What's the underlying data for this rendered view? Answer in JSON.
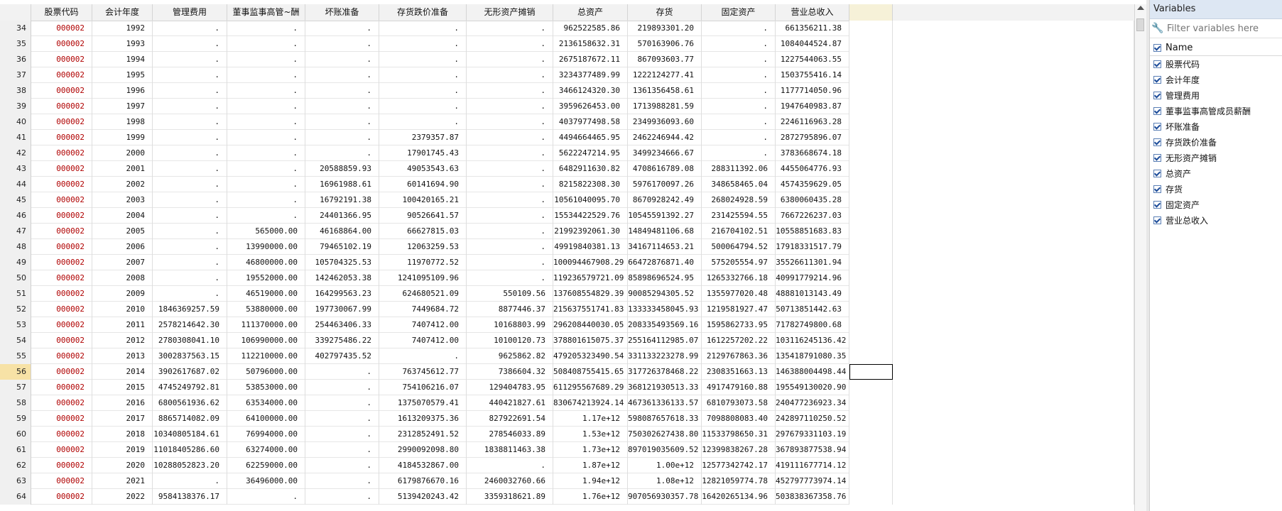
{
  "columns": [
    "",
    "股票代码",
    "会计年度",
    "管理费用",
    "董事监事高管~酬",
    "坏账准备",
    "存货跌价准备",
    "无形资产摊销",
    "总资产",
    "存货",
    "固定资产",
    "营业总收入",
    ""
  ],
  "rows": [
    [
      "34",
      "000002",
      "1992",
      ".",
      ".",
      ".",
      ".",
      ".",
      "962522585.86",
      "219893301.20",
      ".",
      "661356211.38"
    ],
    [
      "35",
      "000002",
      "1993",
      ".",
      ".",
      ".",
      ".",
      ".",
      "2136158632.31",
      "570163906.76",
      ".",
      "1084044524.87"
    ],
    [
      "36",
      "000002",
      "1994",
      ".",
      ".",
      ".",
      ".",
      ".",
      "2675187672.11",
      "867093603.77",
      ".",
      "1227544063.55"
    ],
    [
      "37",
      "000002",
      "1995",
      ".",
      ".",
      ".",
      ".",
      ".",
      "3234377489.99",
      "1222124277.41",
      ".",
      "1503755416.14"
    ],
    [
      "38",
      "000002",
      "1996",
      ".",
      ".",
      ".",
      ".",
      ".",
      "3466124320.30",
      "1361356458.61",
      ".",
      "1177714050.96"
    ],
    [
      "39",
      "000002",
      "1997",
      ".",
      ".",
      ".",
      ".",
      ".",
      "3959626453.00",
      "1713988281.59",
      ".",
      "1947640983.87"
    ],
    [
      "40",
      "000002",
      "1998",
      ".",
      ".",
      ".",
      ".",
      ".",
      "4037977498.58",
      "2349936093.60",
      ".",
      "2246116963.28"
    ],
    [
      "41",
      "000002",
      "1999",
      ".",
      ".",
      ".",
      "2379357.87",
      ".",
      "4494664465.95",
      "2462246944.42",
      ".",
      "2872795896.07"
    ],
    [
      "42",
      "000002",
      "2000",
      ".",
      ".",
      ".",
      "17901745.43",
      ".",
      "5622247214.95",
      "3499234666.67",
      ".",
      "3783668674.18"
    ],
    [
      "43",
      "000002",
      "2001",
      ".",
      ".",
      "20588859.93",
      "49053543.63",
      ".",
      "6482911630.82",
      "4708616789.08",
      "288311392.06",
      "4455064776.93"
    ],
    [
      "44",
      "000002",
      "2002",
      ".",
      ".",
      "16961988.61",
      "60141694.90",
      ".",
      "8215822308.30",
      "5976170097.26",
      "348658465.04",
      "4574359629.05"
    ],
    [
      "45",
      "000002",
      "2003",
      ".",
      ".",
      "16792191.38",
      "100420165.21",
      ".",
      "10561040095.70",
      "8670928242.49",
      "268024928.59",
      "6380060435.28"
    ],
    [
      "46",
      "000002",
      "2004",
      ".",
      ".",
      "24401366.95",
      "90526641.57",
      ".",
      "15534422529.76",
      "10545591392.27",
      "231425594.55",
      "7667226237.03"
    ],
    [
      "47",
      "000002",
      "2005",
      ".",
      "565000.00",
      "46168864.00",
      "66627815.03",
      ".",
      "21992392061.30",
      "14849481106.68",
      "216704102.51",
      "10558851683.83"
    ],
    [
      "48",
      "000002",
      "2006",
      ".",
      "13990000.00",
      "79465102.19",
      "12063259.53",
      ".",
      "49919840381.13",
      "34167114653.21",
      "500064794.52",
      "17918331517.79"
    ],
    [
      "49",
      "000002",
      "2007",
      ".",
      "46800000.00",
      "105704325.53",
      "11970772.52",
      ".",
      "100094467908.29",
      "66472876871.40",
      "575205554.97",
      "35526611301.94"
    ],
    [
      "50",
      "000002",
      "2008",
      ".",
      "19552000.00",
      "142462053.38",
      "1241095109.96",
      ".",
      "119236579721.09",
      "85898696524.95",
      "1265332766.18",
      "40991779214.96"
    ],
    [
      "51",
      "000002",
      "2009",
      ".",
      "46519000.00",
      "164299563.23",
      "624680521.09",
      "550109.56",
      "137608554829.39",
      "90085294305.52",
      "1355977020.48",
      "48881013143.49"
    ],
    [
      "52",
      "000002",
      "2010",
      "1846369257.59",
      "53880000.00",
      "197730067.99",
      "7449684.72",
      "8877446.37",
      "215637551741.83",
      "133333458045.93",
      "1219581927.47",
      "50713851442.63"
    ],
    [
      "53",
      "000002",
      "2011",
      "2578214642.30",
      "111370000.00",
      "254463406.33",
      "7407412.00",
      "10168803.99",
      "296208440030.05",
      "208335493569.16",
      "1595862733.95",
      "71782749800.68"
    ],
    [
      "54",
      "000002",
      "2012",
      "2780308041.10",
      "106990000.00",
      "339275486.22",
      "7407412.00",
      "10100120.73",
      "378801615075.37",
      "255164112985.07",
      "1612257202.22",
      "103116245136.42"
    ],
    [
      "55",
      "000002",
      "2013",
      "3002837563.15",
      "112210000.00",
      "402797435.52",
      ".",
      "9625862.82",
      "479205323490.54",
      "331133223278.99",
      "2129767863.36",
      "135418791080.35"
    ],
    [
      "56",
      "000002",
      "2014",
      "3902617687.02",
      "50796000.00",
      ".",
      "763745612.77",
      "7386604.32",
      "508408755415.65",
      "317726378468.22",
      "2308351663.13",
      "146388004498.44"
    ],
    [
      "57",
      "000002",
      "2015",
      "4745249792.81",
      "53853000.00",
      ".",
      "754106216.07",
      "129404783.95",
      "611295567689.29",
      "368121930513.33",
      "4917479160.88",
      "195549130020.90"
    ],
    [
      "58",
      "000002",
      "2016",
      "6800561936.62",
      "63534000.00",
      ".",
      "1375070579.41",
      "440421827.61",
      "830674213924.14",
      "467361336133.57",
      "6810793073.58",
      "240477236923.34"
    ],
    [
      "59",
      "000002",
      "2017",
      "8865714082.09",
      "64100000.00",
      ".",
      "1613209375.36",
      "827922691.54",
      "1.17e+12",
      "598087657618.33",
      "7098808083.40",
      "242897110250.52"
    ],
    [
      "60",
      "000002",
      "2018",
      "10340805184.61",
      "76994000.00",
      ".",
      "2312852491.52",
      "278546033.89",
      "1.53e+12",
      "750302627438.80",
      "11533798650.31",
      "297679331103.19"
    ],
    [
      "61",
      "000002",
      "2019",
      "11018405286.60",
      "63274000.00",
      ".",
      "2990092098.80",
      "1838811463.38",
      "1.73e+12",
      "897019035609.52",
      "12399838267.28",
      "367893877538.94"
    ],
    [
      "62",
      "000002",
      "2020",
      "10288052823.20",
      "62259000.00",
      ".",
      "4184532867.00",
      ".",
      "1.87e+12",
      "1.00e+12",
      "12577342742.17",
      "419111677714.12"
    ],
    [
      "63",
      "000002",
      "2021",
      ".",
      "36496000.00",
      ".",
      "6179876670.16",
      "2460032760.66",
      "1.94e+12",
      "1.08e+12",
      "12821059774.78",
      "452797773974.14"
    ],
    [
      "64",
      "000002",
      "2022",
      "9584138376.17",
      ".",
      ".",
      "5139420243.42",
      "3359318621.89",
      "1.76e+12",
      "907056930357.78",
      "16420265134.96",
      "503838367358.76"
    ]
  ],
  "active_row": "56",
  "variables_panel": {
    "title": "Variables",
    "filter_placeholder": "Filter variables here",
    "header": "Name",
    "items": [
      "股票代码",
      "会计年度",
      "管理费用",
      "董事监事高管成员薪酬",
      "坏账准备",
      "存货跌价准备",
      "无形资产摊销",
      "总资产",
      "存货",
      "固定资产",
      "营业总收入"
    ]
  },
  "colors": {
    "code_text": "#b00000",
    "active_row_header": "#f7e2a6",
    "panel_title_bg": "#dde7f3"
  }
}
